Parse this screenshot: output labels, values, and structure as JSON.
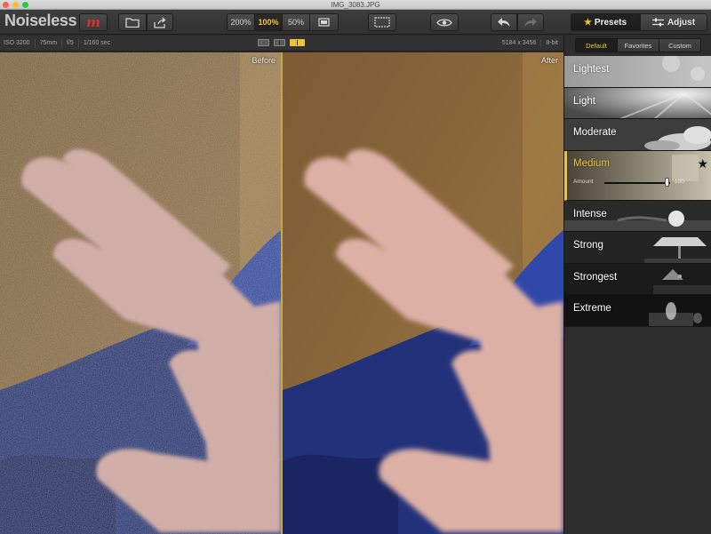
{
  "window": {
    "title": "IMG_3083.JPG"
  },
  "toolbar": {
    "app_name": "Noiseless",
    "plugin_logo": "m",
    "open_icon": "folder-icon",
    "share_icon": "share-icon",
    "zoom_levels": [
      "200%",
      "100%",
      "50%"
    ],
    "active_zoom": "100%",
    "fit_icon": "fit-screen-icon",
    "compare_icon": "eye-icon",
    "undo_icon": "undo-arrow-icon",
    "redo_icon": "redo-arrow-icon",
    "presets_label": "Presets",
    "adjust_label": "Adjust"
  },
  "info": {
    "iso": "ISO 3200",
    "focal": "75mm",
    "aperture": "f/5",
    "shutter": "1/160 sec",
    "dimensions": "5184 x 3456",
    "bit_depth": "8-bit"
  },
  "view": {
    "before_label": "Before",
    "after_label": "After"
  },
  "panel": {
    "tabs": [
      "Default",
      "Favorites",
      "Custom"
    ],
    "active_tab": "Default",
    "presets": [
      {
        "label": "Lightest"
      },
      {
        "label": "Light"
      },
      {
        "label": "Moderate"
      },
      {
        "label": "Medium",
        "selected": true
      },
      {
        "label": "Intense"
      },
      {
        "label": "Strong"
      },
      {
        "label": "Strongest"
      },
      {
        "label": "Extreme"
      }
    ],
    "amount_label": "Amount",
    "amount_value": "100",
    "amount_fraction": 0.95
  },
  "colors": {
    "accent": "#f0c23c",
    "close": "#fc5f57",
    "minimize": "#fdbc2e",
    "maximize": "#28c840"
  }
}
